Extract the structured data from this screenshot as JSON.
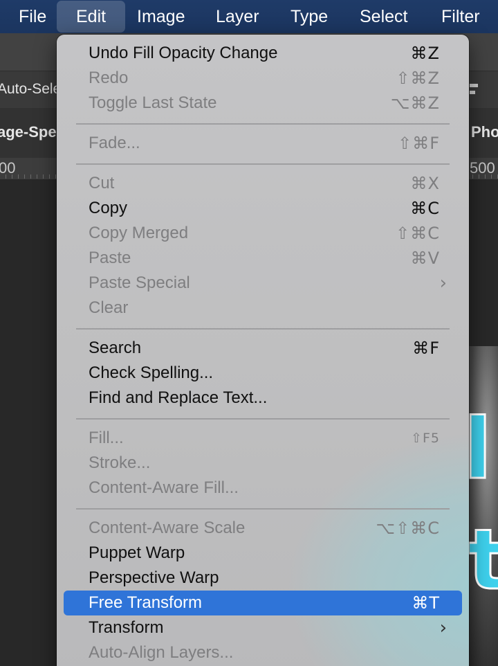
{
  "menubar": {
    "items": [
      {
        "label": "File"
      },
      {
        "label": "Edit"
      },
      {
        "label": "Image"
      },
      {
        "label": "Layer"
      },
      {
        "label": "Type"
      },
      {
        "label": "Select"
      },
      {
        "label": "Filter"
      }
    ]
  },
  "background": {
    "auto_select_label": "Auto-Sele",
    "doc_tab_left": "age-Spe",
    "doc_tab_right": "Pho",
    "ruler_left": "00",
    "ruler_right": "500"
  },
  "edit_menu": {
    "items": [
      {
        "label": "Undo Fill Opacity Change",
        "shortcut": "⌘Z"
      },
      {
        "label": "Redo",
        "shortcut": "⇧⌘Z"
      },
      {
        "label": "Toggle Last State",
        "shortcut": "⌥⌘Z"
      },
      {
        "label": "Fade...",
        "shortcut": "⇧⌘F"
      },
      {
        "label": "Cut",
        "shortcut": "⌘X"
      },
      {
        "label": "Copy",
        "shortcut": "⌘C"
      },
      {
        "label": "Copy Merged",
        "shortcut": "⇧⌘C"
      },
      {
        "label": "Paste",
        "shortcut": "⌘V"
      },
      {
        "label": "Paste Special",
        "submenu": "›"
      },
      {
        "label": "Clear"
      },
      {
        "label": "Search",
        "shortcut": "⌘F"
      },
      {
        "label": "Check Spelling..."
      },
      {
        "label": "Find and Replace Text..."
      },
      {
        "label": "Fill...",
        "shortcut": "⇧F5"
      },
      {
        "label": "Stroke..."
      },
      {
        "label": "Content-Aware Fill..."
      },
      {
        "label": "Content-Aware Scale",
        "shortcut": "⌥⇧⌘C"
      },
      {
        "label": "Puppet Warp"
      },
      {
        "label": "Perspective Warp"
      },
      {
        "label": "Free Transform",
        "shortcut": "⌘T"
      },
      {
        "label": "Transform",
        "submenu": "›"
      },
      {
        "label": "Auto-Align Layers..."
      }
    ]
  },
  "colors": {
    "menubar_bg": "#1f3b68",
    "highlight": "#2f74d8",
    "menu_bg": "#c2c2c4",
    "disabled_text": "#7e7e80",
    "canvas_accent": "#3ed0ec"
  }
}
